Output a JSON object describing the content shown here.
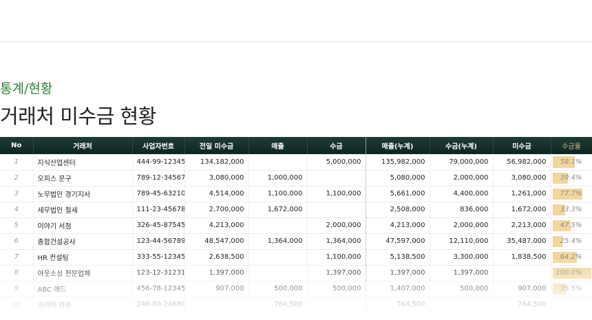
{
  "header": {
    "breadcrumb": "통계/현황",
    "title": "거래처 미수금 현황"
  },
  "table": {
    "columns": [
      "No",
      "거래처",
      "사업자번호",
      "전일 미수금",
      "매출",
      "수금",
      "매출(누계)",
      "수금(누계)",
      "미수금",
      "수금율"
    ],
    "rows": [
      {
        "no": "1",
        "name": "지식산업센터",
        "bizno": "444-99-12345",
        "prev": "134,182,000",
        "sales": "",
        "collect": "5,000,000",
        "sales_cum": "135,982,000",
        "collect_cum": "79,000,000",
        "unpaid": "56,982,000",
        "rate": "58.1%",
        "rate_val": 58.1
      },
      {
        "no": "2",
        "name": "오피스 문구",
        "bizno": "789-12-34567",
        "prev": "3,080,000",
        "sales": "1,000,000",
        "collect": "",
        "sales_cum": "5,080,000",
        "collect_cum": "2,000,000",
        "unpaid": "3,080,000",
        "rate": "39.4%",
        "rate_val": 39.4
      },
      {
        "no": "3",
        "name": "노무법인 경기지사",
        "bizno": "789-45-63210",
        "prev": "4,514,000",
        "sales": "1,100,000",
        "collect": "1,100,000",
        "sales_cum": "5,661,000",
        "collect_cum": "4,400,000",
        "unpaid": "1,261,000",
        "rate": "77.7%",
        "rate_val": 77.7
      },
      {
        "no": "4",
        "name": "세무법인 절세",
        "bizno": "111-23-45678",
        "prev": "2,700,000",
        "sales": "1,672,000",
        "collect": "",
        "sales_cum": "2,508,000",
        "collect_cum": "836,000",
        "unpaid": "1,672,000",
        "rate": "33.3%",
        "rate_val": 33.3
      },
      {
        "no": "5",
        "name": "이야기 서점",
        "bizno": "326-45-87545",
        "prev": "4,213,000",
        "sales": "",
        "collect": "2,000,000",
        "sales_cum": "4,213,000",
        "collect_cum": "2,000,000",
        "unpaid": "2,213,000",
        "rate": "47.5%",
        "rate_val": 47.5
      },
      {
        "no": "6",
        "name": "종합건설공사",
        "bizno": "123-44-56789",
        "prev": "48,547,000",
        "sales": "1,364,000",
        "collect": "1,364,000",
        "sales_cum": "47,597,000",
        "collect_cum": "12,110,000",
        "unpaid": "35,487,000",
        "rate": "25.4%",
        "rate_val": 25.4
      },
      {
        "no": "7",
        "name": "HR 컨설팅",
        "bizno": "333-55-12345",
        "prev": "2,638,500",
        "sales": "",
        "collect": "1,100,000",
        "sales_cum": "5,138,500",
        "collect_cum": "3,300,000",
        "unpaid": "1,838,500",
        "rate": "64.2%",
        "rate_val": 64.2
      },
      {
        "no": "8",
        "name": "아웃소싱 전문업체",
        "bizno": "123-12-31231",
        "prev": "1,397,000",
        "sales": "",
        "collect": "1,397,000",
        "sales_cum": "1,397,000",
        "collect_cum": "1,397,000",
        "unpaid": "",
        "rate": "100.0%",
        "rate_val": 100.0
      },
      {
        "no": "9",
        "name": "ABC 애드",
        "bizno": "456-78-12345",
        "prev": "907,000",
        "sales": "500,000",
        "collect": "500,000",
        "sales_cum": "1,407,000",
        "collect_cum": "500,000",
        "unpaid": "907,000",
        "rate": "35.5%",
        "rate_val": 35.5
      },
      {
        "no": "10",
        "name": "코리아 관광",
        "bizno": "246-80-24680",
        "prev": "",
        "sales": "764,500",
        "collect": "",
        "sales_cum": "764,500",
        "collect_cum": "",
        "unpaid": "764,500",
        "rate": "",
        "rate_val": 0
      }
    ]
  },
  "colors": {
    "header_bg": "#0f2621",
    "breadcrumb": "#2e7d32",
    "rate_bar": "#f0cf8b"
  }
}
